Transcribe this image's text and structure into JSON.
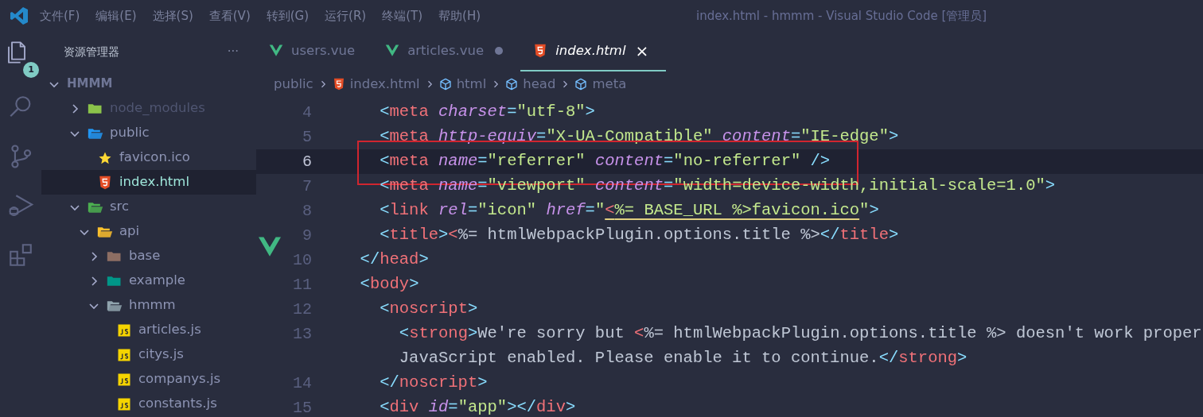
{
  "window": {
    "title": "index.html - hmmm - Visual Studio Code [管理员]"
  },
  "menu": [
    "文件(F)",
    "编辑(E)",
    "选择(S)",
    "查看(V)",
    "转到(G)",
    "运行(R)",
    "终端(T)",
    "帮助(H)"
  ],
  "activity_bar": {
    "explorer_badge": "1"
  },
  "sidebar": {
    "title": "资源管理器",
    "more": "···",
    "root": {
      "name": "HMMM",
      "expanded": true,
      "children": [
        {
          "name": "node_modules",
          "kind": "folder",
          "color": "#8bc34a",
          "expanded": false,
          "ignored": true,
          "selected": false
        },
        {
          "name": "public",
          "kind": "folder",
          "color": "#2196f3",
          "expanded": true,
          "ignored": false,
          "selected": false,
          "children": [
            {
              "name": "favicon.ico",
              "kind": "star-file",
              "ignored": false,
              "selected": false
            },
            {
              "name": "index.html",
              "kind": "html-file",
              "ignored": false,
              "selected": true
            }
          ]
        },
        {
          "name": "src",
          "kind": "folder",
          "color": "#4caf50",
          "expanded": true,
          "ignored": false,
          "selected": false,
          "children": [
            {
              "name": "api",
              "kind": "folder",
              "color": "#fbc02d",
              "expanded": true,
              "ignored": false,
              "selected": false,
              "children": [
                {
                  "name": "base",
                  "kind": "folder",
                  "color": "#8d6e63",
                  "expanded": false,
                  "ignored": false,
                  "selected": false
                },
                {
                  "name": "example",
                  "kind": "folder",
                  "color": "#009688",
                  "expanded": false,
                  "ignored": false,
                  "selected": false
                },
                {
                  "name": "hmmm",
                  "kind": "folder",
                  "color": "#90a4ae",
                  "expanded": true,
                  "ignored": false,
                  "selected": false,
                  "children": [
                    {
                      "name": "articles.js",
                      "kind": "js-file",
                      "ignored": false,
                      "selected": false
                    },
                    {
                      "name": "citys.js",
                      "kind": "js-file",
                      "ignored": false,
                      "selected": false
                    },
                    {
                      "name": "companys.js",
                      "kind": "js-file",
                      "ignored": false,
                      "selected": false
                    },
                    {
                      "name": "constants.js",
                      "kind": "js-file",
                      "ignored": false,
                      "selected": false
                    }
                  ]
                }
              ]
            }
          ]
        }
      ]
    }
  },
  "tabs": [
    {
      "label": "users.vue",
      "kind": "vue",
      "selected": false,
      "modified": false
    },
    {
      "label": "articles.vue",
      "kind": "vue",
      "selected": false,
      "modified": true
    },
    {
      "label": "index.html",
      "kind": "html",
      "selected": true,
      "modified": false,
      "close": "×"
    }
  ],
  "breadcrumbs": [
    {
      "label": "public",
      "kind": "folder"
    },
    {
      "label": "index.html",
      "kind": "html"
    },
    {
      "label": "html",
      "kind": "element"
    },
    {
      "label": "head",
      "kind": "element"
    },
    {
      "label": "meta",
      "kind": "element"
    }
  ],
  "editor": {
    "lines": [
      {
        "number": "4",
        "current": false,
        "boxed": false,
        "tokens": [
          {
            "kind": "punct",
            "text": "    <"
          },
          {
            "kind": "tag",
            "text": "meta"
          },
          {
            "kind": "attr",
            "text": " charset"
          },
          {
            "kind": "punct",
            "text": "="
          },
          {
            "kind": "str",
            "text": "\"utf-8\""
          },
          {
            "kind": "punct",
            "text": ">"
          }
        ]
      },
      {
        "number": "5",
        "current": false,
        "boxed": false,
        "tokens": [
          {
            "kind": "punct",
            "text": "    <"
          },
          {
            "kind": "tag",
            "text": "meta"
          },
          {
            "kind": "attr",
            "text": " http-equiv"
          },
          {
            "kind": "punct",
            "text": "="
          },
          {
            "kind": "str",
            "text": "\"X-UA-Compatible\""
          },
          {
            "kind": "attr",
            "text": " content"
          },
          {
            "kind": "punct",
            "text": "="
          },
          {
            "kind": "str",
            "text": "\"IE-edge\""
          },
          {
            "kind": "punct",
            "text": ">"
          }
        ]
      },
      {
        "number": "6",
        "current": true,
        "boxed": true,
        "tokens": [
          {
            "kind": "punct",
            "text": "    <"
          },
          {
            "kind": "tag",
            "text": "meta"
          },
          {
            "kind": "attr",
            "text": " name"
          },
          {
            "kind": "punct",
            "text": "="
          },
          {
            "kind": "str",
            "text": "\"referrer\""
          },
          {
            "kind": "attr",
            "text": " content"
          },
          {
            "kind": "punct",
            "text": "="
          },
          {
            "kind": "str",
            "text": "\"no-referrer\""
          },
          {
            "kind": "punct",
            "text": " />"
          }
        ]
      },
      {
        "number": "7",
        "current": false,
        "boxed": false,
        "tokens": [
          {
            "kind": "punct",
            "text": "    <"
          },
          {
            "kind": "tag",
            "text": "meta"
          },
          {
            "kind": "attr",
            "text": " name"
          },
          {
            "kind": "punct",
            "text": "="
          },
          {
            "kind": "str",
            "text": "\"viewport\""
          },
          {
            "kind": "attr",
            "text": " content"
          },
          {
            "kind": "punct",
            "text": "="
          },
          {
            "kind": "str",
            "text": "\"width=device-width,initial-scale=1.0\""
          },
          {
            "kind": "punct",
            "text": ">"
          }
        ]
      },
      {
        "number": "8",
        "current": false,
        "boxed": false,
        "tokens": [
          {
            "kind": "punct",
            "text": "    <"
          },
          {
            "kind": "tag",
            "text": "link"
          },
          {
            "kind": "attr",
            "text": " rel"
          },
          {
            "kind": "punct",
            "text": "="
          },
          {
            "kind": "str",
            "text": "\"icon\""
          },
          {
            "kind": "attr",
            "text": " href"
          },
          {
            "kind": "punct",
            "text": "="
          },
          {
            "kind": "str",
            "text": "\""
          },
          {
            "kind": "ejs",
            "text": "<",
            "underline": true
          },
          {
            "kind": "str",
            "text": "%= BASE_URL %>favicon.ico",
            "underline": true
          },
          {
            "kind": "str",
            "text": "\""
          },
          {
            "kind": "punct",
            "text": ">"
          }
        ]
      },
      {
        "number": "9",
        "current": false,
        "boxed": false,
        "tokens": [
          {
            "kind": "punct",
            "text": "    <"
          },
          {
            "kind": "tag",
            "text": "title"
          },
          {
            "kind": "punct",
            "text": ">"
          },
          {
            "kind": "ejs",
            "text": "<"
          },
          {
            "kind": "text",
            "text": "%= htmlWebpackPlugin.options.title %>"
          },
          {
            "kind": "punct",
            "text": "</"
          },
          {
            "kind": "tag",
            "text": "title"
          },
          {
            "kind": "punct",
            "text": ">"
          }
        ]
      },
      {
        "number": "10",
        "current": false,
        "boxed": false,
        "tokens": [
          {
            "kind": "punct",
            "text": "  </"
          },
          {
            "kind": "tag",
            "text": "head"
          },
          {
            "kind": "punct",
            "text": ">"
          }
        ]
      },
      {
        "number": "11",
        "current": false,
        "boxed": false,
        "tokens": [
          {
            "kind": "punct",
            "text": "  <"
          },
          {
            "kind": "tag",
            "text": "body"
          },
          {
            "kind": "punct",
            "text": ">"
          }
        ]
      },
      {
        "number": "12",
        "current": false,
        "boxed": false,
        "tokens": [
          {
            "kind": "punct",
            "text": "    <"
          },
          {
            "kind": "tag",
            "text": "noscript"
          },
          {
            "kind": "punct",
            "text": ">"
          }
        ]
      },
      {
        "number": "13",
        "current": false,
        "boxed": false,
        "tokens": [
          {
            "kind": "punct",
            "text": "      <"
          },
          {
            "kind": "tag",
            "text": "strong"
          },
          {
            "kind": "punct",
            "text": ">"
          },
          {
            "kind": "text",
            "text": "We're sorry but "
          },
          {
            "kind": "ejs",
            "text": "<"
          },
          {
            "kind": "text",
            "text": "%= htmlWebpackPlugin.options.title %> doesn't work proper"
          }
        ]
      },
      {
        "current": false,
        "boxed": false,
        "tokens": [
          {
            "kind": "text",
            "text": "      JavaScript enabled. Please enable it to continue."
          },
          {
            "kind": "punct",
            "text": "</"
          },
          {
            "kind": "tag",
            "text": "strong"
          },
          {
            "kind": "punct",
            "text": ">"
          }
        ]
      },
      {
        "number": "14",
        "current": false,
        "boxed": false,
        "tokens": [
          {
            "kind": "punct",
            "text": "    </"
          },
          {
            "kind": "tag",
            "text": "noscript"
          },
          {
            "kind": "punct",
            "text": ">"
          }
        ]
      },
      {
        "number": "15",
        "current": false,
        "boxed": false,
        "tokens": [
          {
            "kind": "punct",
            "text": "    <"
          },
          {
            "kind": "tag",
            "text": "div"
          },
          {
            "kind": "attr",
            "text": " id"
          },
          {
            "kind": "punct",
            "text": "="
          },
          {
            "kind": "str",
            "text": "\"app\""
          },
          {
            "kind": "punct",
            "text": "></"
          },
          {
            "kind": "tag",
            "text": "div"
          },
          {
            "kind": "punct",
            "text": ">"
          }
        ]
      }
    ]
  }
}
